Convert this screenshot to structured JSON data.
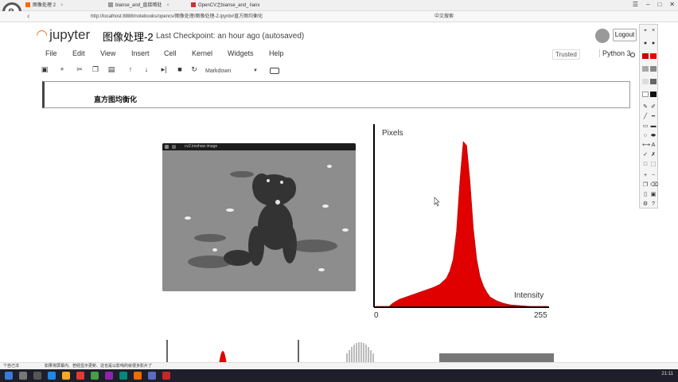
{
  "browser": {
    "tabs": [
      {
        "label": "图像处理 2",
        "color": "#ff6600"
      },
      {
        "label": "bianse_and_直接暗处",
        "color": "#555555"
      },
      {
        "label": "OpenCV之bianse_and_ lianx",
        "color": "#d32f2f"
      }
    ],
    "url": "http://localhost:8888/notebooks/opencv/图像处理/图像处理-2.ipynb#直方图均衡化",
    "search_hint": "中文搜索"
  },
  "jupyter": {
    "logo_text": "jupyter",
    "notebook_title": "图像处理-2",
    "checkpoint": "Last Checkpoint: an hour ago (autosaved)",
    "logout_label": "Logout",
    "menu": [
      "File",
      "Edit",
      "View",
      "Insert",
      "Cell",
      "Kernel",
      "Widgets",
      "Help"
    ],
    "trusted_label": "Trusted",
    "kernel_label": "Python 3",
    "cell_type": "Markdown"
  },
  "cell": {
    "heading": "直方图均衡化"
  },
  "image_window": {
    "title": "cv2.imshow image"
  },
  "chart_data": {
    "type": "area",
    "ylabel": "Pixels",
    "xlabel": "Intensity",
    "xlim": [
      0,
      255
    ],
    "x_ticks": [
      "0",
      "255"
    ],
    "color": "#e00000",
    "x": [
      0,
      20,
      25,
      35,
      45,
      55,
      65,
      75,
      85,
      95,
      105,
      110,
      115,
      120,
      125,
      130,
      135,
      140,
      145,
      150,
      155,
      160,
      165,
      170,
      180,
      190,
      200,
      215,
      230,
      255
    ],
    "y": [
      0,
      0,
      4,
      9,
      12,
      15,
      18,
      21,
      24,
      28,
      36,
      45,
      60,
      95,
      160,
      210,
      205,
      160,
      100,
      60,
      38,
      26,
      18,
      12,
      7,
      4,
      2,
      1,
      0,
      0
    ],
    "ylim": [
      0,
      230
    ]
  },
  "status": {
    "left": "个自己法",
    "message": "如果将屏幕内、若经显示更新、这也是以影响的就很多影片了"
  },
  "taskbar": {
    "clock": "21:11"
  },
  "icons": {
    "logo": "browser-logo-icon",
    "kernel": "kernel-status-icon"
  }
}
